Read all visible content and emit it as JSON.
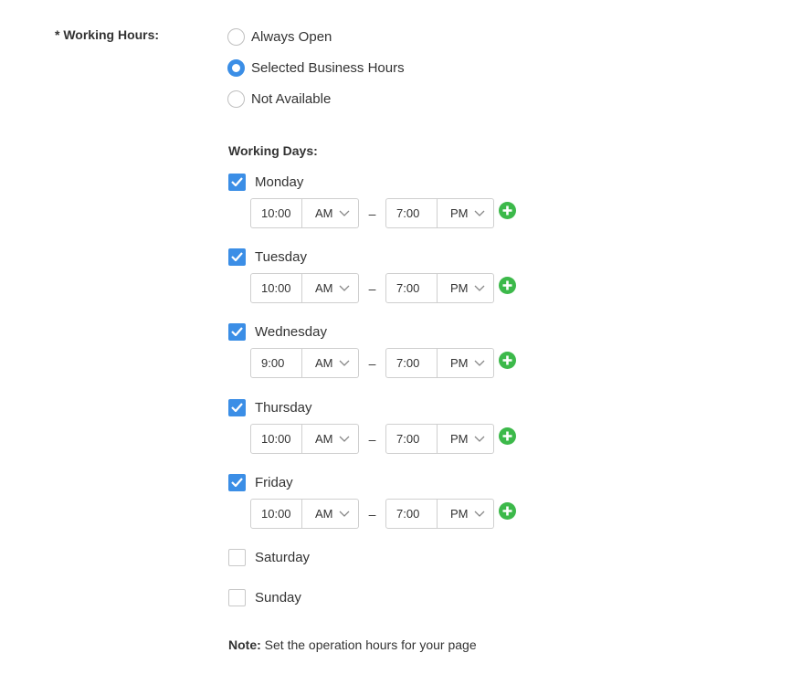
{
  "field": {
    "label": "* Working Hours:"
  },
  "hours_mode": {
    "options": [
      {
        "label": "Always Open",
        "selected": false
      },
      {
        "label": "Selected Business Hours",
        "selected": true
      },
      {
        "label": "Not Available",
        "selected": false
      }
    ]
  },
  "working_days": {
    "title": "Working Days:",
    "days": [
      {
        "name": "Monday",
        "checked": true,
        "start": "10:00",
        "start_period": "AM",
        "end": "7:00",
        "end_period": "PM"
      },
      {
        "name": "Tuesday",
        "checked": true,
        "start": "10:00",
        "start_period": "AM",
        "end": "7:00",
        "end_period": "PM"
      },
      {
        "name": "Wednesday",
        "checked": true,
        "start": "9:00",
        "start_period": "AM",
        "end": "7:00",
        "end_period": "PM"
      },
      {
        "name": "Thursday",
        "checked": true,
        "start": "10:00",
        "start_period": "AM",
        "end": "7:00",
        "end_period": "PM"
      },
      {
        "name": "Friday",
        "checked": true,
        "start": "10:00",
        "start_period": "AM",
        "end": "7:00",
        "end_period": "PM"
      },
      {
        "name": "Saturday",
        "checked": false
      },
      {
        "name": "Sunday",
        "checked": false
      }
    ],
    "separator": "–"
  },
  "note": {
    "label": "Note:",
    "text": "Set the operation hours for your page"
  },
  "colors": {
    "accent": "#3b8ee6",
    "add": "#3cb94a",
    "border": "#cfcfcf",
    "text": "#333333"
  },
  "icons": {
    "add": "plus-circle-icon",
    "dropdown": "chevron-down-icon",
    "check": "checkmark-icon"
  }
}
